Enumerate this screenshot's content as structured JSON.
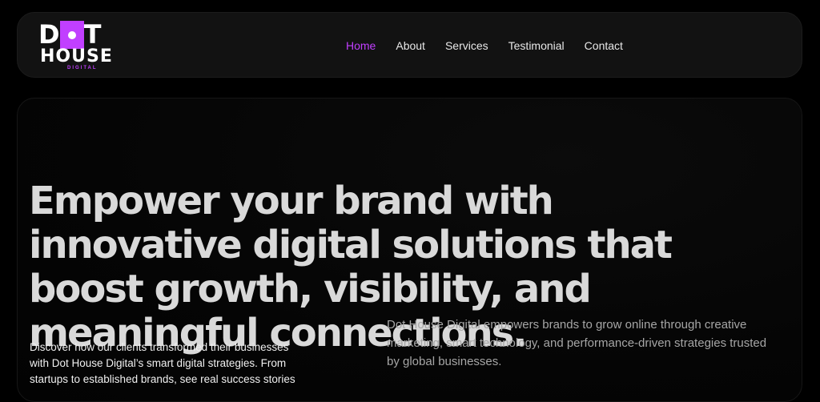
{
  "logo": {
    "line1_d": "D",
    "line1_t": "T",
    "line2": "HOUSE",
    "tagline": "DIGITAL"
  },
  "nav": {
    "items": [
      {
        "label": "Home"
      },
      {
        "label": "About"
      },
      {
        "label": "Services"
      },
      {
        "label": "Testimonial"
      },
      {
        "label": "Contact"
      }
    ]
  },
  "hero": {
    "headline": "Empower your brand with innovative digital solutions that boost growth, visibility, and meaningful connections.",
    "left_text": "Discover how our clients transformed their businesses with Dot House Digital’s smart digital strategies. From startups to established brands, see real success stories",
    "right_text": "Dot House Digital empowers brands to grow online through creative marketing, smart technology, and performance-driven strategies trusted by global businesses."
  },
  "colors": {
    "accent": "#c13fff",
    "background": "#000000"
  }
}
